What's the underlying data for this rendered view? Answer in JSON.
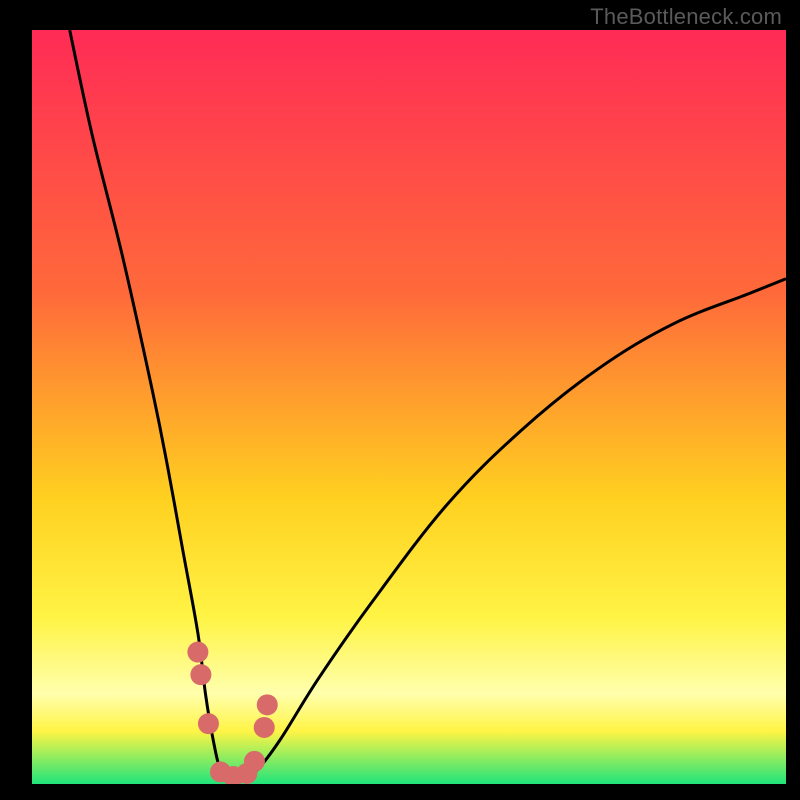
{
  "watermark": "TheBottleneck.com",
  "colors": {
    "background": "#000000",
    "gradient_top": "#ff2b56",
    "gradient_mid1": "#ff6a3a",
    "gradient_mid2": "#ffd020",
    "gradient_mid3": "#fff445",
    "gradient_band_pale": "#ffffad",
    "gradient_bottom": "#20e47a",
    "curve": "#000000",
    "marker": "#d86a6a"
  },
  "chart_data": {
    "type": "line",
    "title": "",
    "xlabel": "",
    "ylabel": "",
    "xlim": [
      0,
      100
    ],
    "ylim": [
      0,
      100
    ],
    "series": [
      {
        "name": "bottleneck-curve",
        "x": [
          5,
          8,
          12,
          16,
          18,
          20,
          22,
          23,
          24,
          25,
          26.5,
          28,
          30,
          33,
          38,
          45,
          55,
          65,
          75,
          85,
          95,
          100
        ],
        "y": [
          100,
          86,
          70,
          52,
          42,
          31,
          20,
          12,
          6,
          2,
          0.5,
          0.5,
          2,
          6,
          14,
          24,
          37,
          47,
          55,
          61,
          65,
          67
        ]
      }
    ],
    "markers": {
      "name": "highlight-points",
      "x": [
        22.0,
        22.4,
        23.4,
        25.0,
        26.7,
        28.5,
        29.5,
        30.8,
        31.2
      ],
      "y": [
        17.5,
        14.5,
        8.0,
        1.6,
        1.0,
        1.4,
        3.0,
        7.5,
        10.5
      ]
    }
  }
}
